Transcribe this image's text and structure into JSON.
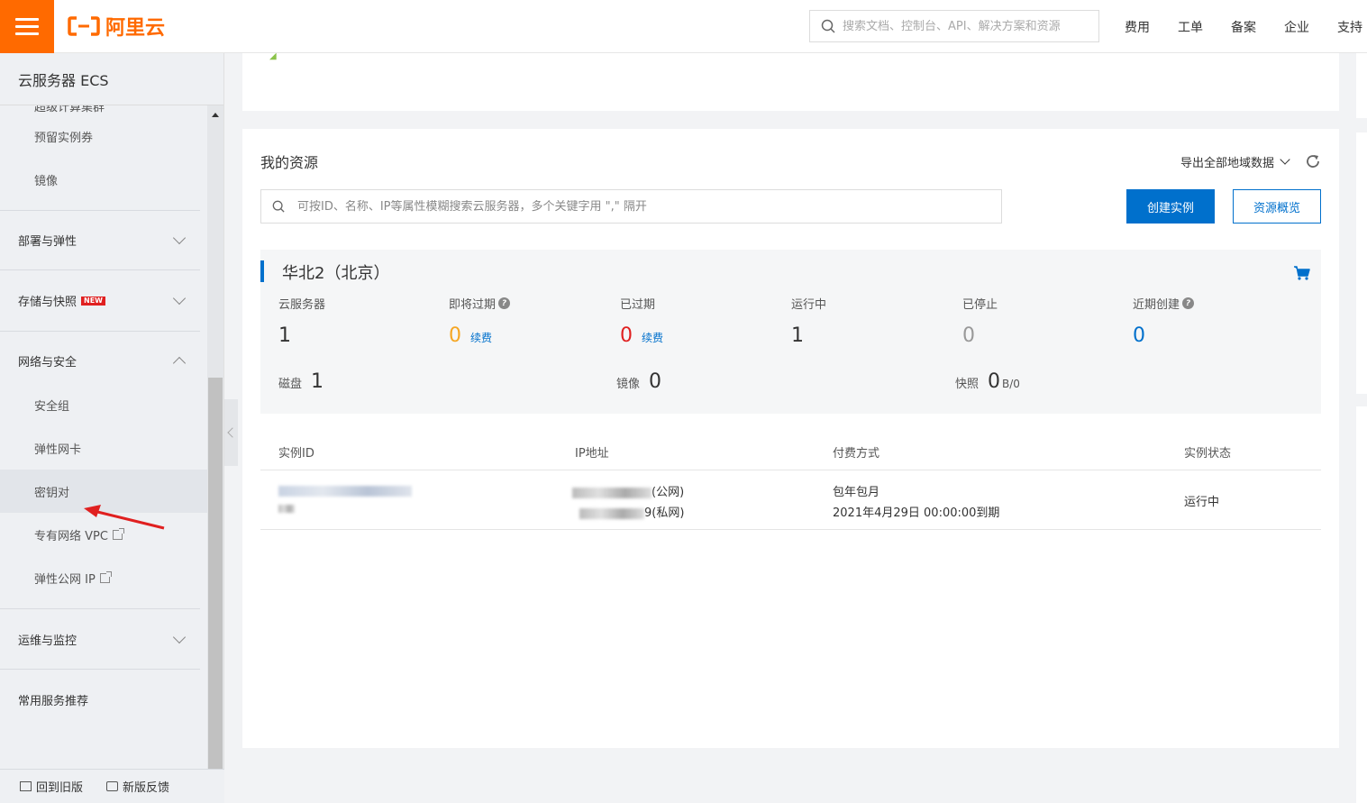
{
  "header": {
    "logo_text": "阿里云",
    "search_placeholder": "搜索文档、控制台、API、解决方案和资源",
    "nav": [
      "费用",
      "工单",
      "备案",
      "企业",
      "支持"
    ]
  },
  "sidebar": {
    "title": "云服务器 ECS",
    "cut_item": "超级计算集群",
    "items_top": [
      "预留实例券",
      "镜像"
    ],
    "group_deploy": "部署与弹性",
    "group_storage": "存储与快照",
    "new_badge": "NEW",
    "group_network": "网络与安全",
    "network_items": [
      "安全组",
      "弹性网卡",
      "密钥对",
      "专有网络 VPC",
      "弹性公网 IP"
    ],
    "group_ops": "运维与监控",
    "group_common": "常用服务推荐",
    "footer_back": "回到旧版",
    "footer_feedback": "新版反馈"
  },
  "resources": {
    "title": "我的资源",
    "export_label": "导出全部地域数据",
    "search_placeholder": "可按ID、名称、IP等属性模糊搜索云服务器，多个关键字用 \",\" 隔开",
    "create_button": "创建实例",
    "overview_button": "资源概览",
    "region": {
      "name": "华北2（北京）",
      "stats": [
        {
          "label": "云服务器",
          "value": "1"
        },
        {
          "label": "即将过期",
          "value": "0",
          "renew": "续费"
        },
        {
          "label": "已过期",
          "value": "0",
          "renew": "续费"
        },
        {
          "label": "运行中",
          "value": "1"
        },
        {
          "label": "已停止",
          "value": "0"
        },
        {
          "label": "近期创建",
          "value": "0"
        }
      ],
      "disk_label": "磁盘",
      "disk_value": "1",
      "image_label": "镜像",
      "image_value": "0",
      "snapshot_label": "快照",
      "snapshot_value": "0",
      "snapshot_unit": "B/0"
    },
    "table": {
      "headers": [
        "实例ID",
        "IP地址",
        "付费方式",
        "实例状态"
      ],
      "row": {
        "ip_public_suffix": "(公网)",
        "ip_private_suffix": "9(私网)",
        "billing": "包年包月",
        "expiry": "2021年4月29日 00:00:00到期",
        "status": "运行中"
      }
    }
  },
  "colors": {
    "brand": "#ff6a00",
    "primary": "#0070cc",
    "warning": "#f5a623",
    "danger": "#e02020",
    "annotation_arrow": "#e02020"
  }
}
